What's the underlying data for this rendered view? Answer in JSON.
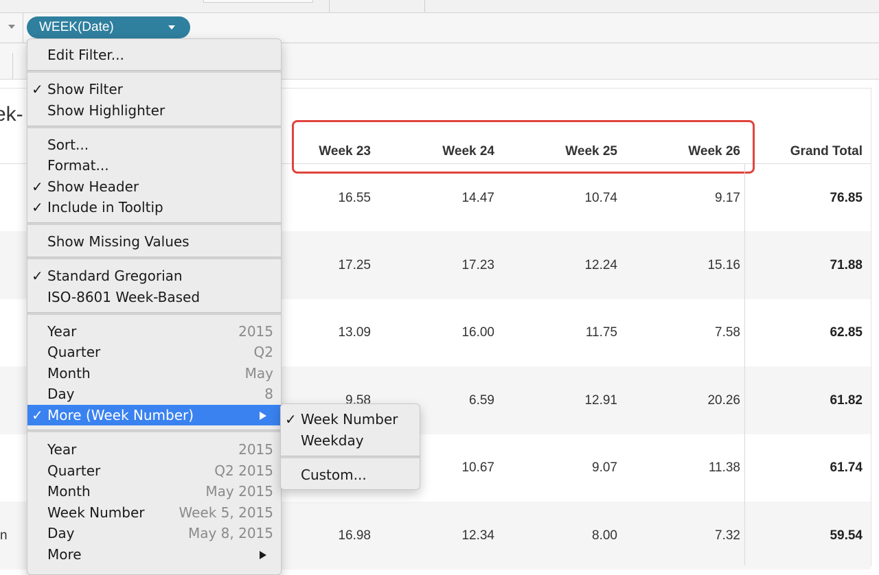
{
  "pill": {
    "label": "WEEK(Date)"
  },
  "sheet": {
    "title_fragment": "ek-"
  },
  "headers": [
    "Week 23",
    "Week 24",
    "Week 25",
    "Week 26",
    "Grand Total"
  ],
  "rows": [
    {
      "label": "",
      "values": [
        "16.55",
        "14.47",
        "10.74",
        "9.17"
      ],
      "total": "76.85"
    },
    {
      "label": "",
      "values": [
        "17.25",
        "17.23",
        "12.24",
        "15.16"
      ],
      "total": "71.88"
    },
    {
      "label": "",
      "values": [
        "13.09",
        "16.00",
        "11.75",
        "7.58"
      ],
      "total": "62.85"
    },
    {
      "label": "",
      "values": [
        "9.58",
        "6.59",
        "12.91",
        "20.26"
      ],
      "total": "61.82"
    },
    {
      "label": "",
      "values": [
        "",
        "10.67",
        "9.07",
        "11.38"
      ],
      "total": "61.74"
    },
    {
      "label": "n",
      "values": [
        "16.98",
        "12.34",
        "8.00",
        "7.32"
      ],
      "total": "59.54"
    }
  ],
  "menu": {
    "edit_filter": "Edit Filter...",
    "show_filter": "Show Filter",
    "show_highlighter": "Show Highlighter",
    "sort": "Sort...",
    "format": "Format...",
    "show_header": "Show Header",
    "include_tooltip": "Include in Tooltip",
    "show_missing": "Show Missing Values",
    "standard_gregorian": "Standard Gregorian",
    "iso_week": "ISO-8601 Week-Based",
    "discrete": [
      {
        "label": "Year",
        "value": "2015"
      },
      {
        "label": "Quarter",
        "value": "Q2"
      },
      {
        "label": "Month",
        "value": "May"
      },
      {
        "label": "Day",
        "value": "8"
      }
    ],
    "more_week_number": "More (Week Number)",
    "continuous": [
      {
        "label": "Year",
        "value": "2015"
      },
      {
        "label": "Quarter",
        "value": "Q2 2015"
      },
      {
        "label": "Month",
        "value": "May 2015"
      },
      {
        "label": "Week Number",
        "value": "Week 5, 2015"
      },
      {
        "label": "Day",
        "value": "May 8, 2015"
      }
    ],
    "more": "More",
    "checkmark": "✓"
  },
  "submenu": {
    "week_number": "Week Number",
    "weekday": "Weekday",
    "custom": "Custom..."
  },
  "colors": {
    "pill": "#2f7f9e",
    "highlight_box": "#e0443d",
    "menu_selected": "#3a82f0"
  }
}
